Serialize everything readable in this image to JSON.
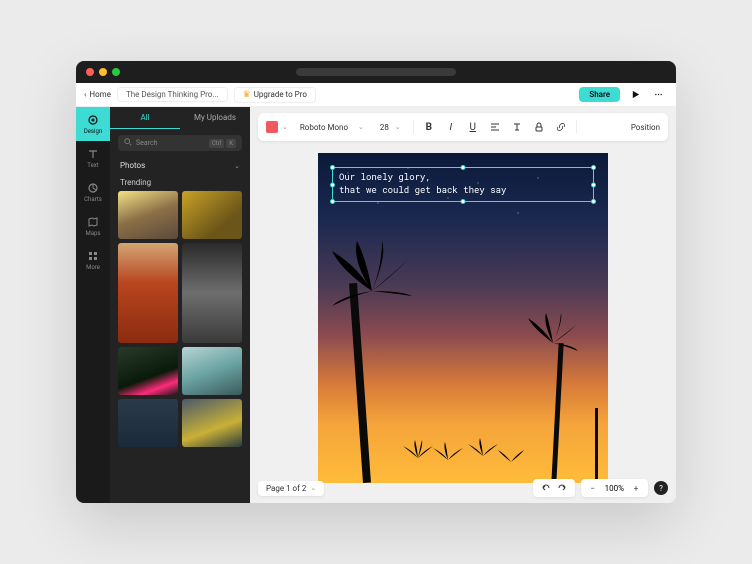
{
  "topbar": {
    "home_label": "Home",
    "project_name": "The Design Thinking Pro...",
    "upgrade_label": "Upgrade to Pro",
    "share_label": "Share"
  },
  "rail": {
    "items": [
      {
        "label": "Design"
      },
      {
        "label": "Text"
      },
      {
        "label": "Charts"
      },
      {
        "label": "Maps"
      },
      {
        "label": "More"
      }
    ]
  },
  "sidepanel": {
    "tabs": [
      {
        "label": "All"
      },
      {
        "label": "My Uploads"
      }
    ],
    "search_placeholder": "Search",
    "kbd1": "Ctrl",
    "kbd2": "K",
    "section": "Photos",
    "trending": "Trending"
  },
  "toolbar": {
    "font": "Roboto Mono",
    "size": "28",
    "position": "Position"
  },
  "canvas": {
    "line1": "Our lonely glory,",
    "line2": "that we could get back they say"
  },
  "bottombar": {
    "page_label": "Page 1 of 2",
    "zoom": "100%"
  }
}
